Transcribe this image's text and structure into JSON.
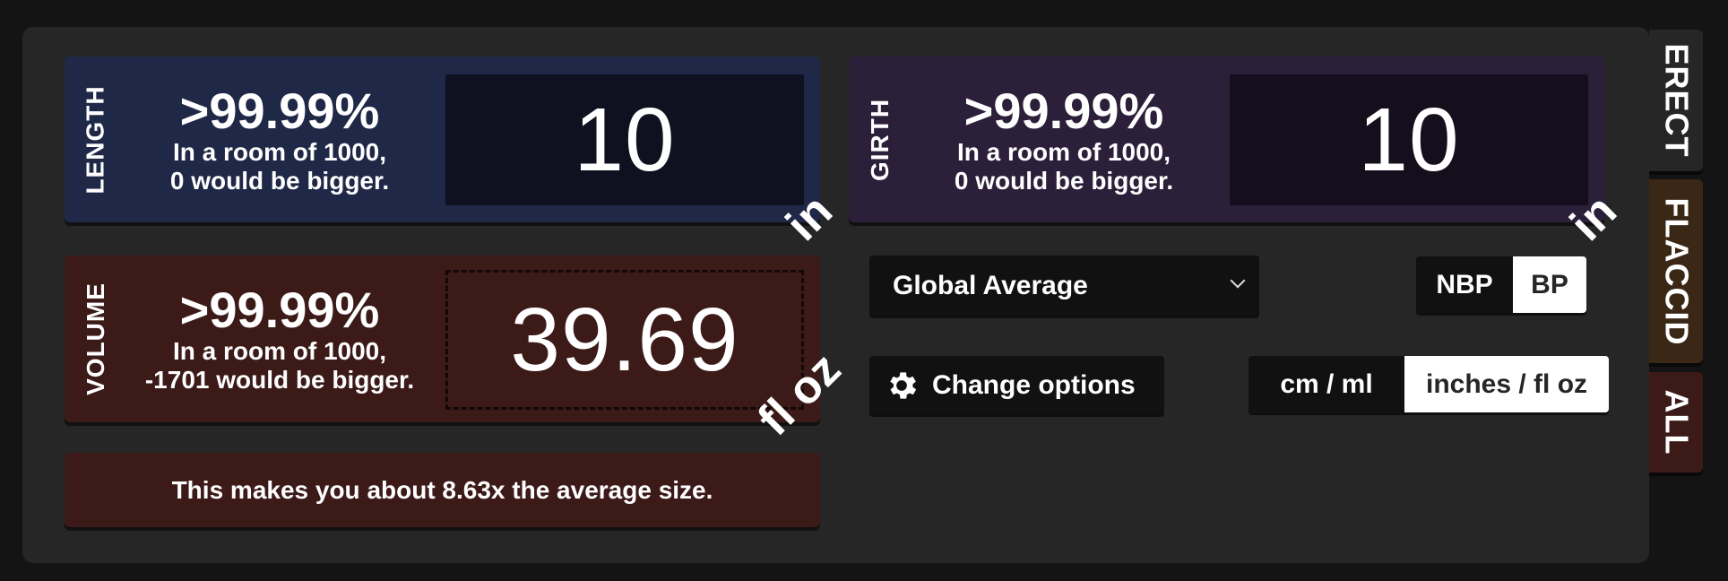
{
  "cards": {
    "length": {
      "label": "LENGTH",
      "percentile": ">99.99%",
      "room_line1": "In a room of 1000,",
      "room_line2": "0 would be bigger.",
      "value": "10",
      "unit": "in"
    },
    "girth": {
      "label": "GIRTH",
      "percentile": ">99.99%",
      "room_line1": "In a room of 1000,",
      "room_line2": "0 would be bigger.",
      "value": "10",
      "unit": "in"
    },
    "volume": {
      "label": "VOLUME",
      "percentile": ">99.99%",
      "room_line1": "In a room of 1000,",
      "room_line2": "-1701 would be bigger.",
      "value": "39.69",
      "unit": "fl oz"
    }
  },
  "summary": "This makes you about 8.63x the average size.",
  "controls": {
    "dataset": "Global Average",
    "options_label": "Change options",
    "bp_toggle": {
      "options": [
        "NBP",
        "BP"
      ],
      "selected": "BP"
    },
    "unit_toggle": {
      "options": [
        "cm / ml",
        "inches / fl oz"
      ],
      "selected": "inches / fl oz"
    }
  },
  "tabs": [
    "ERECT",
    "FLACCID",
    "ALL"
  ],
  "icons": {
    "options": "gear-icon",
    "dropdown": "chevron-down-icon"
  },
  "colors": {
    "length_card": "#1f2846",
    "girth_card": "#2c1f3a",
    "volume_card": "#3b1a18",
    "flaccid_tab": "#3a2716"
  }
}
